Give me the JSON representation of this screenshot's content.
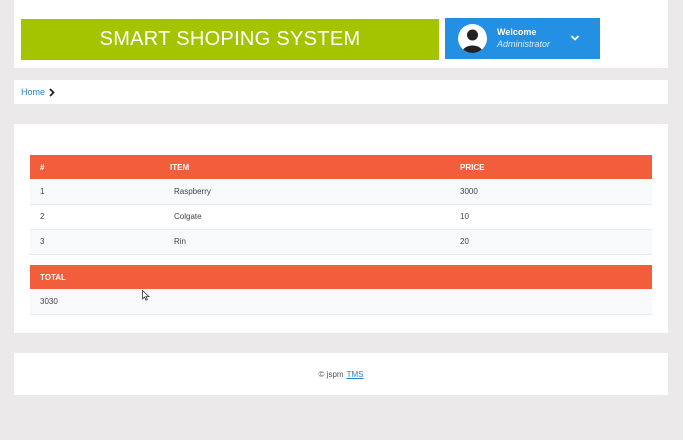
{
  "header": {
    "brand": "SMART SHOPING SYSTEM",
    "user_welcome": "Welcome",
    "user_role": "Administrator",
    "colors": {
      "brand_bg": "#a5c400",
      "user_bg": "#2490e3"
    },
    "icons": {
      "avatar": "user-avatar-icon",
      "dropdown": "chevron-down-icon"
    }
  },
  "breadcrumb": {
    "home": "Home",
    "separator_icon": "chevron-right-icon"
  },
  "items_table": {
    "header_color": "#f25d3b",
    "columns": [
      "#",
      "ITEM",
      "PRICE"
    ],
    "rows": [
      [
        "1",
        "Raspberry",
        "3000"
      ],
      [
        "2",
        "Colgate",
        "10"
      ],
      [
        "3",
        "Rin",
        "20"
      ]
    ]
  },
  "total_table": {
    "label": "TOTAL",
    "value": "3030"
  },
  "footer": {
    "prefix": "© jspm",
    "link": "TMS"
  }
}
